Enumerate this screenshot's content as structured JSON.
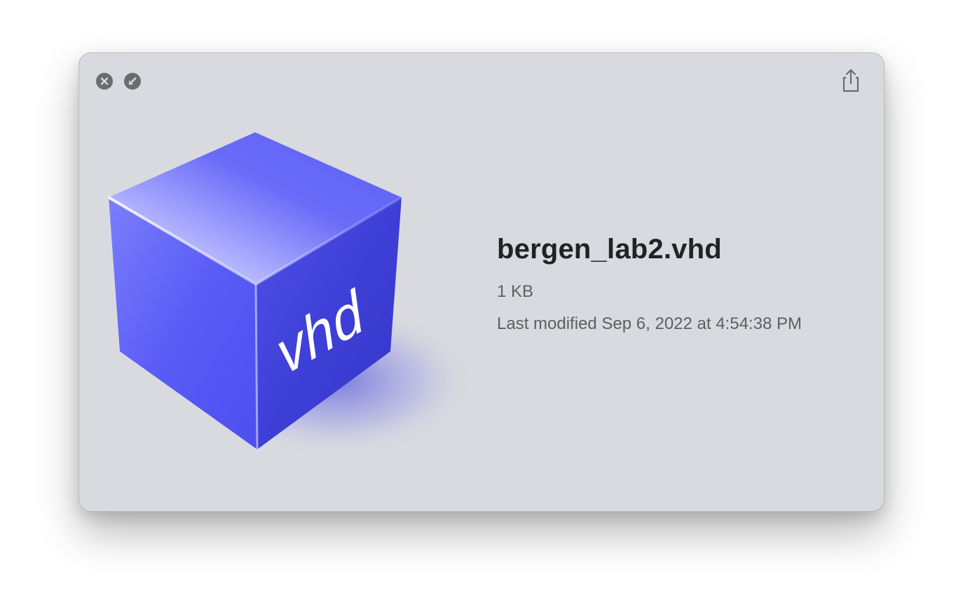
{
  "window": {
    "close_icon": "close-icon",
    "fullscreen_icon": "fullscreen-icon",
    "share_icon": "share-icon"
  },
  "preview": {
    "icon_text": "vhd",
    "accent_color": "#5a5cf0"
  },
  "file": {
    "name": "bergen_lab2.vhd",
    "size": "1 KB",
    "modified": "Last modified Sep 6, 2022 at 4:54:38 PM"
  }
}
